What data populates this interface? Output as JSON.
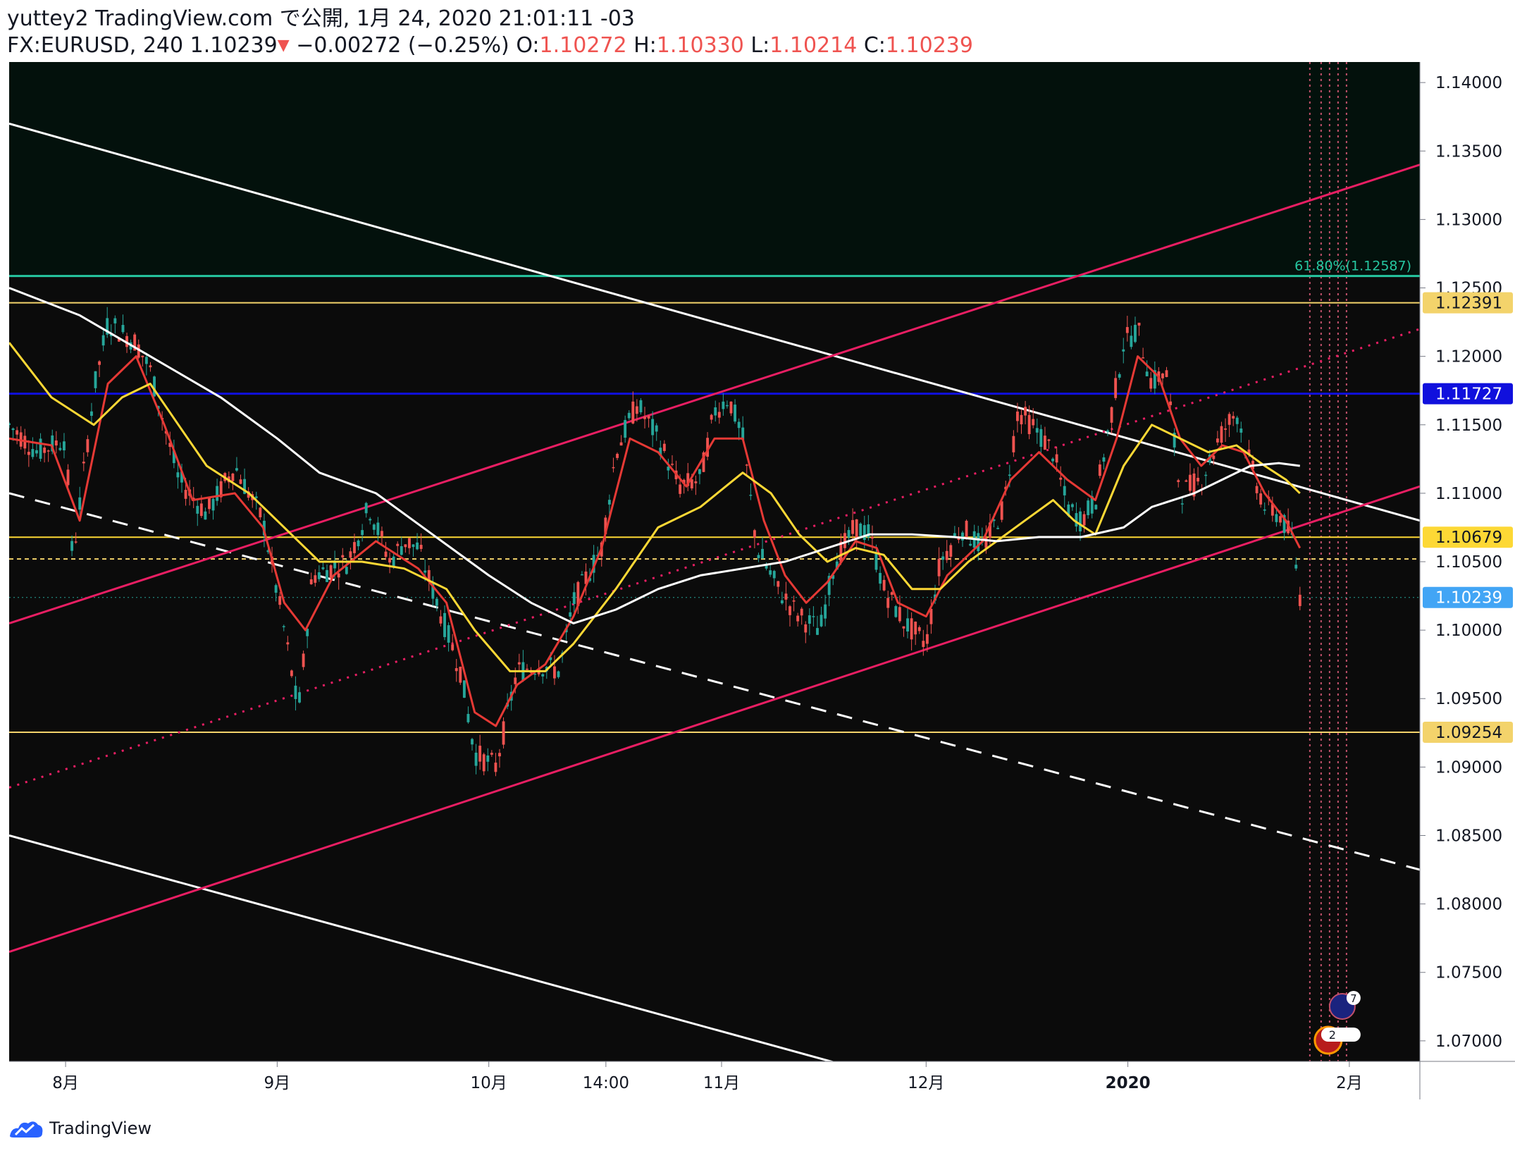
{
  "header": {
    "line1": "yuttey2 TradingView.com で公開, 1月 24, 2020 21:01:11 -03",
    "symbol": "FX:EURUSD, 240",
    "last": "1.10239",
    "down_mark": "▼",
    "change": "−0.00272 (−0.25%)",
    "o_label": "O:",
    "o_value": "1.10272",
    "h_label": "H:",
    "h_value": "1.10330",
    "l_label": "L:",
    "l_value": "1.10214",
    "c_label": "C:",
    "c_value": "1.10239"
  },
  "footer": {
    "brand": "TradingView",
    "logo_icon": "tradingview-logo-icon"
  },
  "colors": {
    "background": "#0b0b0b",
    "top_zone": "#03110c",
    "candle_up": "#26a69a",
    "candle_down": "#ef5350",
    "ma_fast": "#e53935",
    "ma_mid": "#fdd835",
    "ma_slow": "#ffffff",
    "channel": "#e91e63",
    "fib": "#26c6a0",
    "resistance_blue": "#1010dd",
    "level_yellow": "#f3d36b"
  },
  "chart_data": {
    "type": "candlestick",
    "instrument": "FX:EURUSD",
    "timeframe": "240",
    "ylim": [
      1.0685,
      1.1415
    ],
    "y_ticks": [
      "1.14000",
      "1.13500",
      "1.13000",
      "1.12500",
      "1.12000",
      "1.11500",
      "1.11000",
      "1.10500",
      "1.10000",
      "1.09500",
      "1.09000",
      "1.08500",
      "1.08000",
      "1.07500",
      "1.07000"
    ],
    "x_labels": [
      "8月",
      "9月",
      "10月",
      "14:00",
      "11月",
      "12月",
      "2020",
      "2月"
    ],
    "x_label_pos": [
      0.04,
      0.19,
      0.34,
      0.423,
      0.505,
      0.65,
      0.793,
      0.95
    ],
    "price_path": [
      [
        0.0,
        1.115
      ],
      [
        0.02,
        1.113
      ],
      [
        0.04,
        1.114
      ],
      [
        0.045,
        1.105
      ],
      [
        0.06,
        1.1175
      ],
      [
        0.07,
        1.1225
      ],
      [
        0.09,
        1.121
      ],
      [
        0.1,
        1.119
      ],
      [
        0.12,
        1.111
      ],
      [
        0.14,
        1.1085
      ],
      [
        0.16,
        1.112
      ],
      [
        0.18,
        1.108
      ],
      [
        0.195,
        1.1
      ],
      [
        0.205,
        1.094
      ],
      [
        0.215,
        1.104
      ],
      [
        0.24,
        1.105
      ],
      [
        0.255,
        1.109
      ],
      [
        0.27,
        1.105
      ],
      [
        0.28,
        1.1065
      ],
      [
        0.29,
        1.106
      ],
      [
        0.3,
        1.103
      ],
      [
        0.31,
        1.1
      ],
      [
        0.32,
        1.097
      ],
      [
        0.33,
        1.091
      ],
      [
        0.345,
        1.09
      ],
      [
        0.36,
        1.097
      ],
      [
        0.375,
        1.0975
      ],
      [
        0.39,
        1.097
      ],
      [
        0.4,
        1.102
      ],
      [
        0.42,
        1.106
      ],
      [
        0.43,
        1.113
      ],
      [
        0.445,
        1.1165
      ],
      [
        0.46,
        1.114
      ],
      [
        0.475,
        1.1105
      ],
      [
        0.49,
        1.111
      ],
      [
        0.5,
        1.116
      ],
      [
        0.51,
        1.117
      ],
      [
        0.52,
        1.114
      ],
      [
        0.53,
        1.106
      ],
      [
        0.545,
        1.103
      ],
      [
        0.56,
        1.101
      ],
      [
        0.575,
        1.1
      ],
      [
        0.585,
        1.105
      ],
      [
        0.6,
        1.1075
      ],
      [
        0.61,
        1.107
      ],
      [
        0.62,
        1.103
      ],
      [
        0.635,
        1.1005
      ],
      [
        0.65,
        1.099
      ],
      [
        0.66,
        1.105
      ],
      [
        0.675,
        1.1075
      ],
      [
        0.69,
        1.106
      ],
      [
        0.705,
        1.109
      ],
      [
        0.715,
        1.116
      ],
      [
        0.725,
        1.115
      ],
      [
        0.74,
        1.113
      ],
      [
        0.75,
        1.109
      ],
      [
        0.76,
        1.108
      ],
      [
        0.77,
        1.1095
      ],
      [
        0.78,
        1.115
      ],
      [
        0.79,
        1.121
      ],
      [
        0.8,
        1.122
      ],
      [
        0.81,
        1.118
      ],
      [
        0.82,
        1.119
      ],
      [
        0.83,
        1.11
      ],
      [
        0.845,
        1.111
      ],
      [
        0.86,
        1.1145
      ],
      [
        0.87,
        1.116
      ],
      [
        0.88,
        1.112
      ],
      [
        0.89,
        1.109
      ],
      [
        0.9,
        1.1085
      ],
      [
        0.91,
        1.1065
      ],
      [
        0.915,
        1.1025
      ]
    ],
    "moving_averages": [
      {
        "color_key": "ma_fast",
        "points": [
          [
            0.0,
            1.114
          ],
          [
            0.03,
            1.1135
          ],
          [
            0.05,
            1.108
          ],
          [
            0.07,
            1.118
          ],
          [
            0.09,
            1.12
          ],
          [
            0.11,
            1.115
          ],
          [
            0.13,
            1.1095
          ],
          [
            0.16,
            1.11
          ],
          [
            0.18,
            1.1075
          ],
          [
            0.195,
            1.102
          ],
          [
            0.21,
            1.1
          ],
          [
            0.23,
            1.104
          ],
          [
            0.26,
            1.1065
          ],
          [
            0.29,
            1.1045
          ],
          [
            0.31,
            1.102
          ],
          [
            0.33,
            1.094
          ],
          [
            0.345,
            1.093
          ],
          [
            0.36,
            1.096
          ],
          [
            0.38,
            1.0975
          ],
          [
            0.4,
            1.101
          ],
          [
            0.42,
            1.106
          ],
          [
            0.44,
            1.114
          ],
          [
            0.46,
            1.113
          ],
          [
            0.48,
            1.1105
          ],
          [
            0.5,
            1.114
          ],
          [
            0.52,
            1.114
          ],
          [
            0.535,
            1.108
          ],
          [
            0.55,
            1.104
          ],
          [
            0.565,
            1.102
          ],
          [
            0.58,
            1.1035
          ],
          [
            0.6,
            1.1065
          ],
          [
            0.615,
            1.106
          ],
          [
            0.63,
            1.102
          ],
          [
            0.65,
            1.101
          ],
          [
            0.665,
            1.104
          ],
          [
            0.69,
            1.1065
          ],
          [
            0.71,
            1.111
          ],
          [
            0.73,
            1.113
          ],
          [
            0.75,
            1.111
          ],
          [
            0.77,
            1.1095
          ],
          [
            0.785,
            1.114
          ],
          [
            0.8,
            1.12
          ],
          [
            0.815,
            1.1185
          ],
          [
            0.83,
            1.114
          ],
          [
            0.845,
            1.112
          ],
          [
            0.86,
            1.1135
          ],
          [
            0.875,
            1.113
          ],
          [
            0.89,
            1.11
          ],
          [
            0.905,
            1.108
          ],
          [
            0.915,
            1.106
          ]
        ]
      },
      {
        "color_key": "ma_mid",
        "points": [
          [
            0.0,
            1.121
          ],
          [
            0.03,
            1.117
          ],
          [
            0.06,
            1.115
          ],
          [
            0.08,
            1.117
          ],
          [
            0.1,
            1.118
          ],
          [
            0.12,
            1.115
          ],
          [
            0.14,
            1.112
          ],
          [
            0.17,
            1.11
          ],
          [
            0.2,
            1.107
          ],
          [
            0.22,
            1.105
          ],
          [
            0.25,
            1.105
          ],
          [
            0.28,
            1.1045
          ],
          [
            0.31,
            1.103
          ],
          [
            0.33,
            1.1
          ],
          [
            0.355,
            1.097
          ],
          [
            0.38,
            1.097
          ],
          [
            0.4,
            1.099
          ],
          [
            0.43,
            1.103
          ],
          [
            0.46,
            1.1075
          ],
          [
            0.49,
            1.109
          ],
          [
            0.52,
            1.1115
          ],
          [
            0.54,
            1.11
          ],
          [
            0.56,
            1.107
          ],
          [
            0.58,
            1.105
          ],
          [
            0.6,
            1.106
          ],
          [
            0.62,
            1.1055
          ],
          [
            0.64,
            1.103
          ],
          [
            0.66,
            1.103
          ],
          [
            0.68,
            1.105
          ],
          [
            0.7,
            1.1065
          ],
          [
            0.72,
            1.108
          ],
          [
            0.74,
            1.1095
          ],
          [
            0.755,
            1.108
          ],
          [
            0.77,
            1.107
          ],
          [
            0.79,
            1.112
          ],
          [
            0.81,
            1.115
          ],
          [
            0.83,
            1.114
          ],
          [
            0.85,
            1.113
          ],
          [
            0.87,
            1.1135
          ],
          [
            0.89,
            1.112
          ],
          [
            0.905,
            1.111
          ],
          [
            0.915,
            1.11
          ]
        ]
      },
      {
        "color_key": "ma_slow",
        "points": [
          [
            0.0,
            1.125
          ],
          [
            0.05,
            1.123
          ],
          [
            0.1,
            1.12
          ],
          [
            0.15,
            1.117
          ],
          [
            0.19,
            1.114
          ],
          [
            0.22,
            1.1115
          ],
          [
            0.26,
            1.11
          ],
          [
            0.3,
            1.107
          ],
          [
            0.34,
            1.104
          ],
          [
            0.37,
            1.102
          ],
          [
            0.4,
            1.1005
          ],
          [
            0.43,
            1.1015
          ],
          [
            0.46,
            1.103
          ],
          [
            0.49,
            1.104
          ],
          [
            0.52,
            1.1045
          ],
          [
            0.55,
            1.105
          ],
          [
            0.58,
            1.106
          ],
          [
            0.61,
            1.107
          ],
          [
            0.64,
            1.107
          ],
          [
            0.67,
            1.1068
          ],
          [
            0.7,
            1.1065
          ],
          [
            0.73,
            1.1068
          ],
          [
            0.76,
            1.1068
          ],
          [
            0.79,
            1.1075
          ],
          [
            0.81,
            1.109
          ],
          [
            0.84,
            1.11
          ],
          [
            0.86,
            1.111
          ],
          [
            0.88,
            1.112
          ],
          [
            0.9,
            1.1122
          ],
          [
            0.915,
            1.112
          ]
        ]
      }
    ],
    "trend_lines": [
      {
        "color_key": "ma_slow",
        "width": 3,
        "dash": "",
        "from": [
          0.0,
          1.137
        ],
        "to": [
          1.0,
          1.108
        ]
      },
      {
        "color_key": "ma_slow",
        "width": 3,
        "dash": "",
        "from": [
          0.0,
          1.085
        ],
        "to": [
          0.6,
          1.068
        ]
      },
      {
        "color_key": "ma_slow",
        "width": 3,
        "dash": "22 16",
        "from": [
          0.0,
          1.11
        ],
        "to": [
          1.0,
          1.0825
        ]
      },
      {
        "color_key": "channel",
        "width": 3,
        "dash": "",
        "from": [
          0.0,
          1.1005
        ],
        "to": [
          1.0,
          1.134
        ]
      },
      {
        "color_key": "channel",
        "width": 3,
        "dash": "",
        "from": [
          0.0,
          1.0765
        ],
        "to": [
          1.0,
          1.1105
        ]
      },
      {
        "color_key": "channel",
        "width": 3,
        "dash": "3 9",
        "from": [
          0.0,
          1.0885
        ],
        "to": [
          1.0,
          1.122
        ]
      }
    ],
    "levels": [
      {
        "price": 1.12587,
        "color_key": "fib",
        "dash": "",
        "width": 3
      },
      {
        "price": 1.12391,
        "color_key": "level_yellow",
        "dash": "",
        "width": 2
      },
      {
        "price": 1.11727,
        "color_key": "resistance_blue",
        "dash": "",
        "width": 3
      },
      {
        "price": 1.10679,
        "color_key": "ma_mid",
        "dash": "",
        "width": 2
      },
      {
        "price": 1.1052,
        "color_key": "level_yellow",
        "dash": "6 5",
        "width": 2
      },
      {
        "price": 1.10239,
        "color_key": "candle_up",
        "dash": "2 4",
        "width": 1
      },
      {
        "price": 1.09254,
        "color_key": "level_yellow",
        "dash": "",
        "width": 2
      }
    ],
    "top_zone_from": 1.12587,
    "fib_label": "61.80%(1.12587)",
    "price_tags": [
      {
        "price": 1.12391,
        "text": "1.12391",
        "bg": "#f3d36b",
        "fg": "#131722"
      },
      {
        "price": 1.11727,
        "text": "1.11727",
        "bg": "#1010dd",
        "fg": "#ffffff"
      },
      {
        "price": 1.10679,
        "text": "1.10679",
        "bg": "#fdd835",
        "fg": "#131722"
      },
      {
        "price": 1.10239,
        "text": "1.10239",
        "bg": "#42a5f5",
        "fg": "#ffffff"
      },
      {
        "price": 1.09254,
        "text": "1.09254",
        "bg": "#f3d36b",
        "fg": "#131722"
      }
    ],
    "event_lines_x": [
      0.922,
      0.93,
      0.936,
      0.942,
      0.948
    ],
    "event_markers": [
      {
        "icon": "eu-flag-icon",
        "count": "7"
      },
      {
        "icon": "us-flag-icon",
        "count": "2"
      }
    ]
  }
}
